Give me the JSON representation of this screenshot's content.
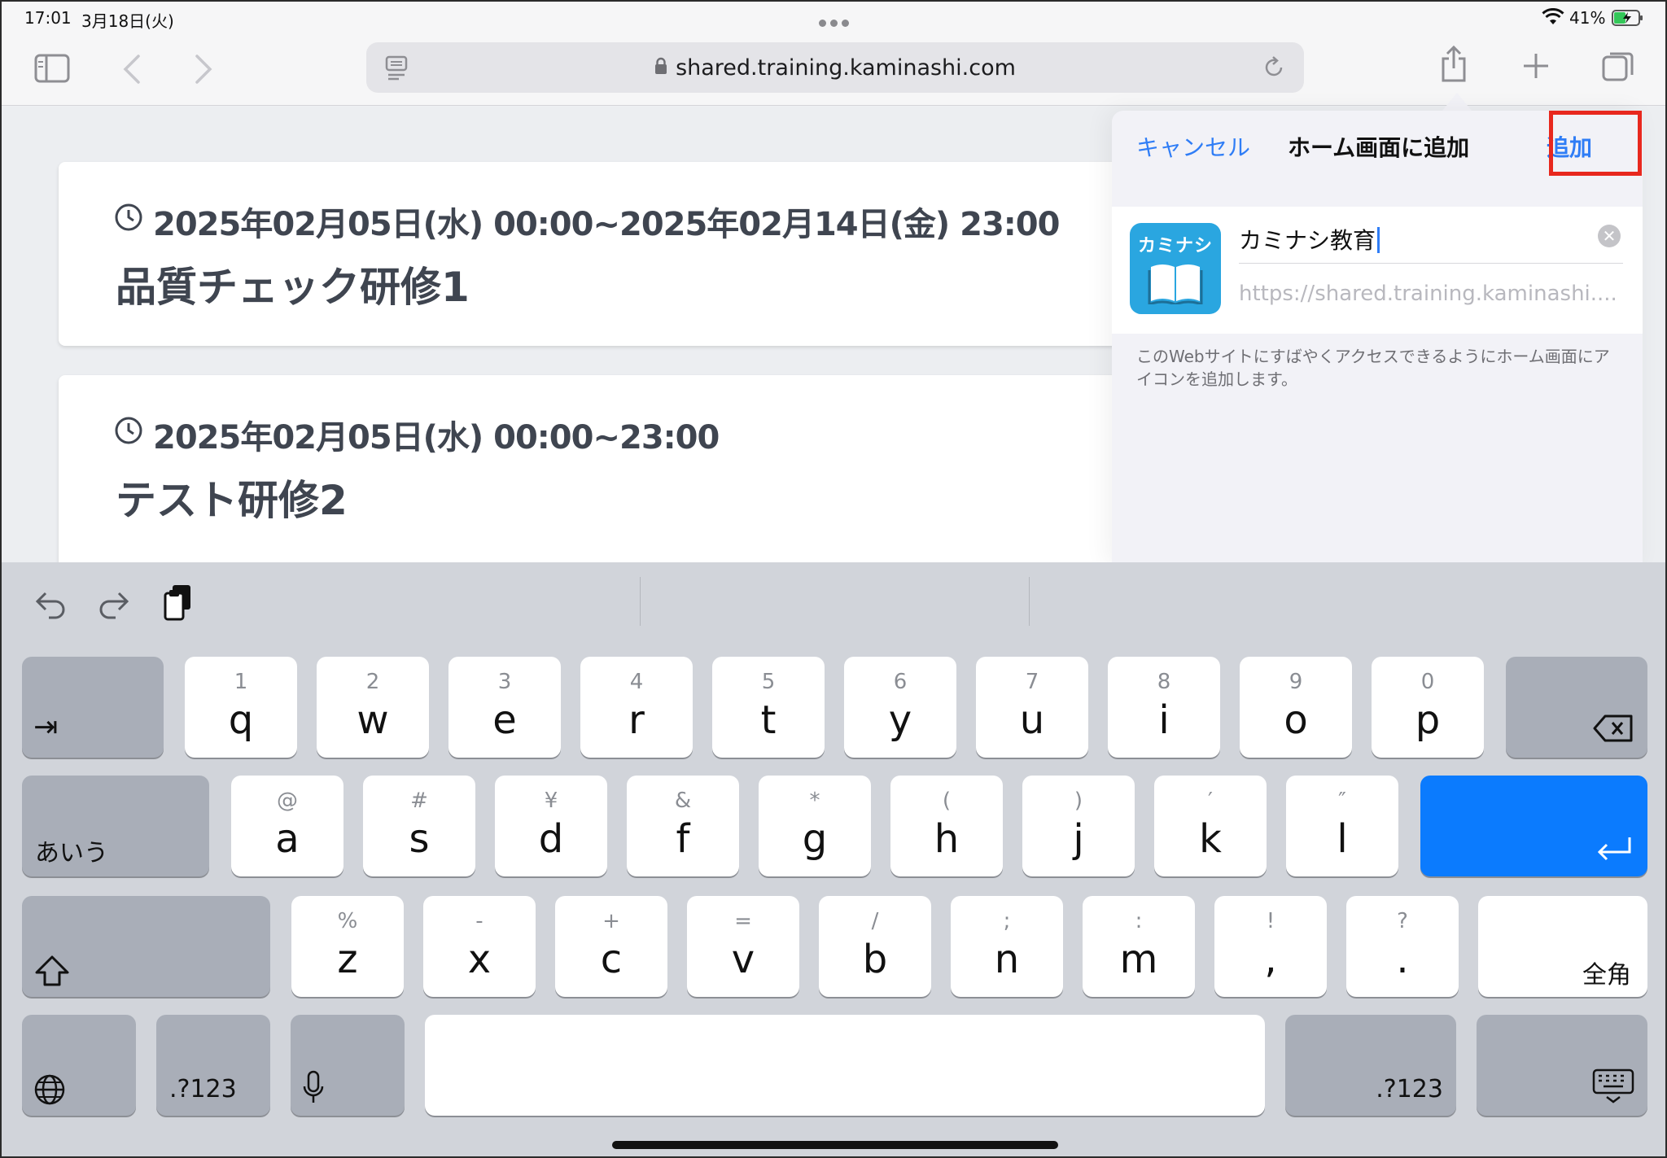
{
  "status_bar": {
    "time": "17:01",
    "date": "3月18日(火)",
    "battery": "41%"
  },
  "browser": {
    "url": "shared.training.kaminashi.com",
    "icons": [
      "sidebar-icon",
      "back-icon",
      "forward-icon",
      "reader-icon",
      "lock-icon",
      "reload-icon",
      "share-icon",
      "new-tab-icon",
      "tabs-icon"
    ]
  },
  "cards": [
    {
      "date": "2025年02月05日(水) 00:00~2025年02月14日(金) 23:00",
      "title": "品質チェック研修1"
    },
    {
      "date": "2025年02月05日(水) 00:00~23:00",
      "title": "テスト研修2"
    }
  ],
  "popover": {
    "cancel": "キャンセル",
    "title": "ホーム画面に追加",
    "add": "追加",
    "app_icon_label": "カミナシ",
    "name_value": "カミナシ教育",
    "url_value": "https://shared.training.kaminashi....",
    "description": "このWebサイトにすばやくアクセスできるようにホーム画面にアイコンを追加します。",
    "colors": {
      "accent": "#2f7df6",
      "highlight": "#e8281e",
      "app_icon": "#2aa6e0"
    }
  },
  "keyboard": {
    "row1": [
      {
        "sub": "1",
        "main": "q"
      },
      {
        "sub": "2",
        "main": "w"
      },
      {
        "sub": "3",
        "main": "e"
      },
      {
        "sub": "4",
        "main": "r"
      },
      {
        "sub": "5",
        "main": "t"
      },
      {
        "sub": "6",
        "main": "y"
      },
      {
        "sub": "7",
        "main": "u"
      },
      {
        "sub": "8",
        "main": "i"
      },
      {
        "sub": "9",
        "main": "o"
      },
      {
        "sub": "0",
        "main": "p"
      }
    ],
    "row2": [
      {
        "sub": "@",
        "main": "a"
      },
      {
        "sub": "#",
        "main": "s"
      },
      {
        "sub": "¥",
        "main": "d"
      },
      {
        "sub": "&",
        "main": "f"
      },
      {
        "sub": "*",
        "main": "g"
      },
      {
        "sub": "(",
        "main": "h"
      },
      {
        "sub": ")",
        "main": "j"
      },
      {
        "sub": "′",
        "main": "k"
      },
      {
        "sub": "″",
        "main": "l"
      }
    ],
    "row3": [
      {
        "sub": "%",
        "main": "z"
      },
      {
        "sub": "-",
        "main": "x"
      },
      {
        "sub": "+",
        "main": "c"
      },
      {
        "sub": "=",
        "main": "v"
      },
      {
        "sub": "/",
        "main": "b"
      },
      {
        "sub": ";",
        "main": "n"
      },
      {
        "sub": ":",
        "main": "m"
      },
      {
        "sub": "!",
        "main": ","
      },
      {
        "sub": "?",
        "main": "."
      }
    ],
    "tab_key": "⇥",
    "kana_key": "あいう",
    "zenkaku_key": "全角",
    "numbers_key": ".?123",
    "colors": {
      "return_key": "#0b7bfe"
    }
  }
}
